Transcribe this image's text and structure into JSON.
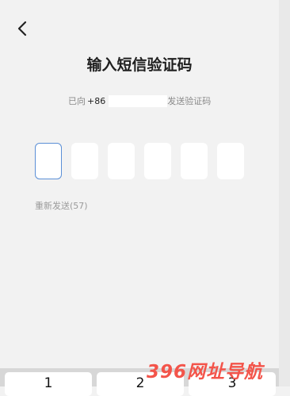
{
  "header": {
    "back_icon": "chevron-left-icon",
    "title": "输入短信验证码"
  },
  "subtitle": {
    "prefix": "已向",
    "phone": "+86",
    "suffix": "发送验证码"
  },
  "otp": {
    "box_count": 6,
    "active_index": 0,
    "active_color": "#5b8fd6"
  },
  "resend": {
    "label": "重新发送(57)"
  },
  "keypad": {
    "keys": [
      "1",
      "2",
      "3"
    ]
  },
  "watermark": {
    "text": "396网址导航"
  }
}
